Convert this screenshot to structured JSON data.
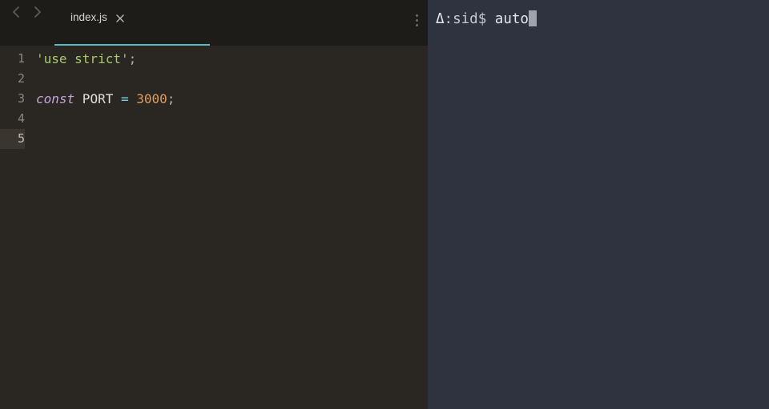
{
  "tabs": {
    "active_label": "index.js"
  },
  "gutter": {
    "1": "1",
    "2": "2",
    "3": "3",
    "4": "4",
    "5": "5"
  },
  "code": {
    "line1": {
      "str": "'use strict'",
      "semi": ";"
    },
    "line3": {
      "keyword": "const",
      "name": " PORT ",
      "eq": "=",
      "num": " 3000",
      "semi": ";"
    }
  },
  "terminal": {
    "prompt_sym": "Δ",
    "prompt_colon": ":",
    "prompt_path": "sid",
    "prompt_dollar": "$ ",
    "command": "auto"
  }
}
